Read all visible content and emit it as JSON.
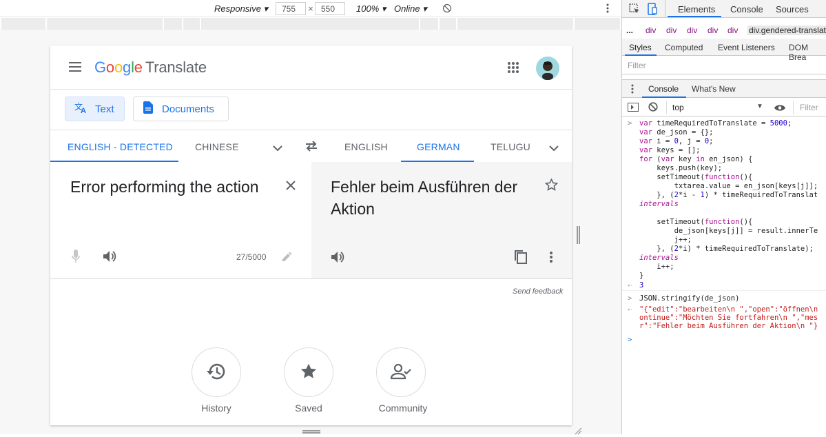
{
  "device_toolbar": {
    "mode": "Responsive",
    "width": "755",
    "times": "×",
    "height": "550",
    "zoom": "100%",
    "network": "Online"
  },
  "translate": {
    "logo_google": [
      "G",
      "o",
      "o",
      "g",
      "l",
      "e"
    ],
    "logo_colors": [
      "#4285f4",
      "#ea4335",
      "#fbbc05",
      "#4285f4",
      "#34a853",
      "#ea4335"
    ],
    "logo_product": "Translate",
    "mode_text": "Text",
    "mode_documents": "Documents",
    "source_langs": [
      "ENGLISH - DETECTED",
      "CHINESE"
    ],
    "target_langs": [
      "ENGLISH",
      "GERMAN",
      "TELUGU"
    ],
    "source_text": "Error performing the action",
    "char_count": "27/5000",
    "target_text_line1": "Fehler beim Ausführen der",
    "target_text_line2": "Aktion",
    "send_feedback": "Send feedback",
    "history": "History",
    "saved": "Saved",
    "community": "Community",
    "accent": "#1a73e8"
  },
  "devtools": {
    "tabs": [
      "Elements",
      "Console",
      "Sources"
    ],
    "breadcrumb": [
      "...",
      "div",
      "div",
      "div",
      "div",
      "div",
      "div.gendered-translat"
    ],
    "style_tabs": [
      "Styles",
      "Computed",
      "Event Listeners",
      "DOM Brea"
    ],
    "filter_placeholder": "Filter",
    "drawer_tabs": [
      "Console",
      "What's New"
    ],
    "context": "top",
    "console_filter": "Filter",
    "console_lines": [
      "var timeRequiredToTranslate = 5000;",
      "var de_json = {};",
      "var i = 0, j = 0;",
      "var keys = [];",
      "for (var key in en_json) {",
      "    keys.push(key);",
      "    setTimeout(function(){",
      "        txtarea.value = en_json[keys[j]];",
      "    }, (2*i - 1) * timeRequiredToTranslat",
      "intervals",
      "",
      "    setTimeout(function(){",
      "        de_json[keys[j]] = result.innerTe",
      "        j++;",
      "    }, (2*i) * timeRequiredToTranslate);",
      "intervals",
      "    i++;",
      "}"
    ],
    "result_1": "3",
    "command_2": "JSON.stringify(de_json)",
    "result_2_lines": [
      "\"{\"edit\":\"bearbeiten\\n \",\"open\":\"öffnen\\n",
      "ontinue\":\"Möchten Sie fortfahren\\n \",\"mes",
      "r\":\"Fehler beim Ausführen der Aktion\\n \"}"
    ]
  }
}
